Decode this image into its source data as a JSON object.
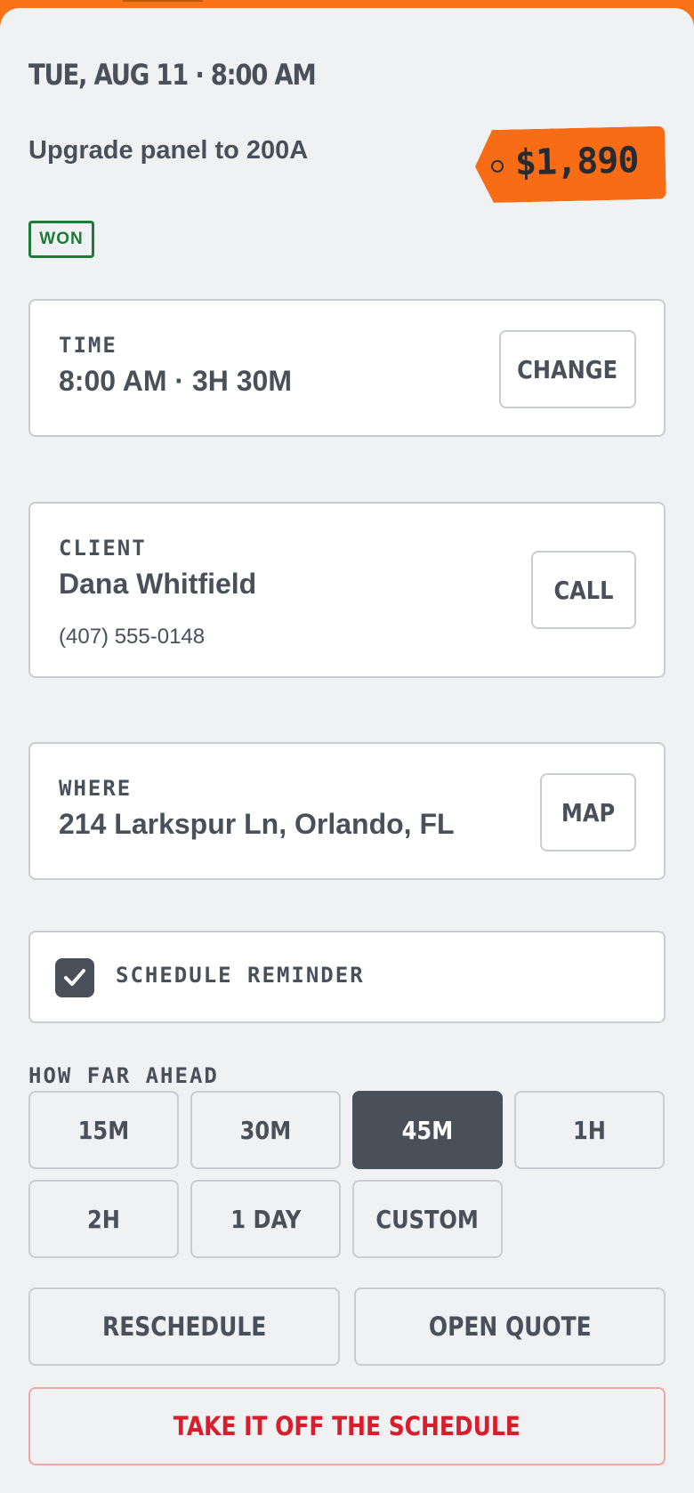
{
  "header": {
    "title": "TUE, AUG 11 · 8:00 AM"
  },
  "job": {
    "title": "Upgrade panel to 200A",
    "price": "$1,890",
    "status": "WON"
  },
  "time_card": {
    "label": "TIME",
    "value": "8:00 AM · 3H 30M",
    "button": "CHANGE"
  },
  "client_card": {
    "label": "CLIENT",
    "name": "Dana Whitfield",
    "phone": "(407) 555-0148",
    "button": "CALL"
  },
  "where_card": {
    "label": "WHERE",
    "address": "214 Larkspur Ln, Orlando, FL",
    "button": "MAP"
  },
  "reminder": {
    "label": "SCHEDULE REMINDER",
    "checked": true
  },
  "how_far": {
    "label": "HOW FAR AHEAD",
    "options": [
      "15M",
      "30M",
      "45M",
      "1H",
      "2H",
      "1 DAY",
      "CUSTOM"
    ],
    "selected": "45M"
  },
  "actions": {
    "reschedule": "RESCHEDULE",
    "open_quote": "OPEN QUOTE",
    "remove": "TAKE IT OFF THE SCHEDULE"
  },
  "colors": {
    "accent": "#f97316",
    "won": "#1f7a3a",
    "danger": "#d81e2c",
    "dark": "#4a5059"
  }
}
